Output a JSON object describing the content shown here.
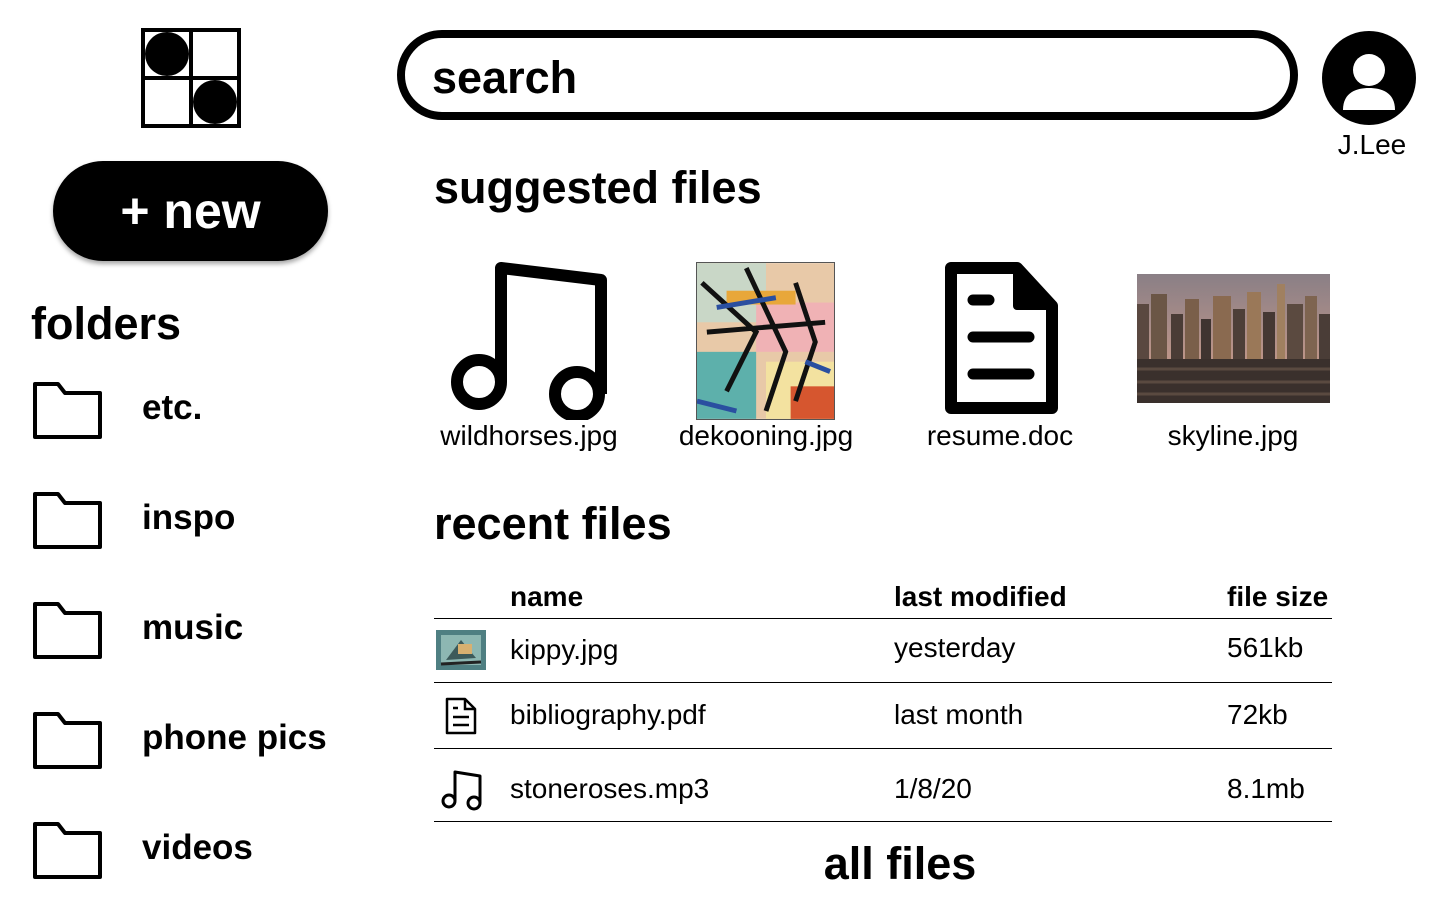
{
  "search": {
    "placeholder": "search"
  },
  "sidebar": {
    "new_label": "+ new",
    "folders_title": "folders",
    "folders": [
      {
        "label": "etc.",
        "icon": "folder-icon"
      },
      {
        "label": "inspo",
        "icon": "folder-icon"
      },
      {
        "label": "music",
        "icon": "folder-icon"
      },
      {
        "label": "phone pics",
        "icon": "folder-icon"
      },
      {
        "label": "videos",
        "icon": "folder-icon"
      }
    ]
  },
  "user": {
    "name": "J.Lee",
    "icon": "user-avatar-icon"
  },
  "suggested": {
    "title": "suggested files",
    "files": [
      {
        "name": "wildhorses.jpg",
        "icon": "music-note-icon"
      },
      {
        "name": "dekooning.jpg",
        "icon": "abstract-painting-thumbnail"
      },
      {
        "name": "resume.doc",
        "icon": "document-icon"
      },
      {
        "name": "skyline.jpg",
        "icon": "city-skyline-thumbnail"
      }
    ]
  },
  "recent": {
    "title": "recent files",
    "columns": {
      "name": "name",
      "modified": "last modified",
      "size": "file size"
    },
    "rows": [
      {
        "name": "kippy.jpg",
        "modified": "yesterday",
        "size": "561kb",
        "icon": "image-thumbnail"
      },
      {
        "name": "bibliography.pdf",
        "modified": "last month",
        "size": "72kb",
        "icon": "document-icon"
      },
      {
        "name": "stoneroses.mp3",
        "modified": "1/8/20",
        "size": "8.1mb",
        "icon": "music-note-icon"
      }
    ]
  },
  "all_files_label": "all files"
}
